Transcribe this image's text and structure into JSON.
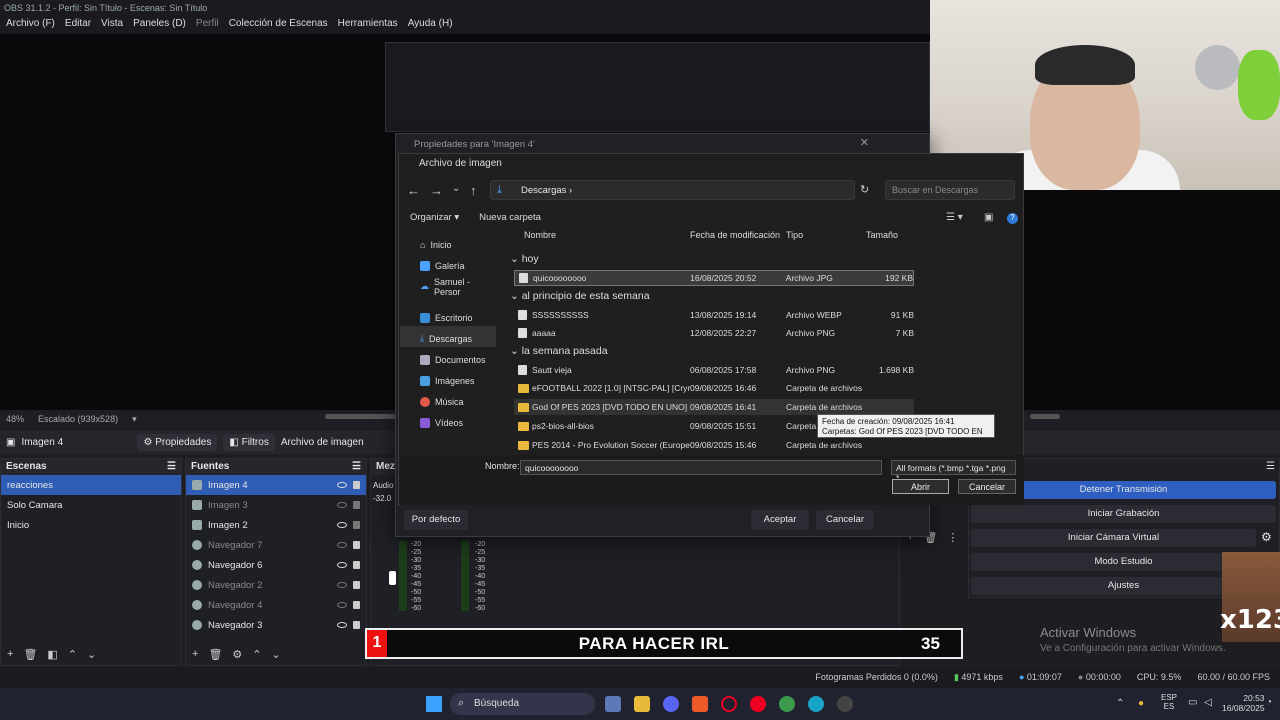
{
  "titlebar": "OBS 31.1.2 - Perfil: Sin Título - Escenas: Sin Título",
  "menu": [
    "Archivo (F)",
    "Editar",
    "Vista",
    "Paneles (D)",
    "Perfil",
    "Colección de Escenas",
    "Herramientas",
    "Ayuda (H)"
  ],
  "previewbar": {
    "zoom": "48%",
    "scale": "Escalado (939x528)"
  },
  "sourcebar": {
    "selected": "Imagen 4",
    "props": "Propiedades",
    "filters": "Filtros",
    "file": "Archivo de imagen"
  },
  "scenes": {
    "title": "Escenas",
    "items": [
      "reacciones",
      "Solo Camara",
      "Inicio"
    ]
  },
  "sources": {
    "title": "Fuentes",
    "items": [
      {
        "name": "Imagen 4",
        "visible": true
      },
      {
        "name": "Imagen 3",
        "visible": false
      },
      {
        "name": "Imagen 2",
        "visible": true
      },
      {
        "name": "Navegador 7",
        "visible": false
      },
      {
        "name": "Navegador 6",
        "visible": true
      },
      {
        "name": "Navegador 2",
        "visible": false
      },
      {
        "name": "Navegador 4",
        "visible": false
      },
      {
        "name": "Navegador 3",
        "visible": true
      }
    ]
  },
  "mixer": {
    "title": "Mezc",
    "audio": "Audio",
    "db": "-32.0",
    "ticks": [
      "-20",
      "-25",
      "-30",
      "-35",
      "-40",
      "-45",
      "-50",
      "-55",
      "-60"
    ]
  },
  "controls": [
    "Detener Transmisión",
    "Iniciar Grabación",
    "Iniciar Cámara Virtual",
    "Modo Estudio",
    "Ajustes"
  ],
  "props_dialog": {
    "title": "Propiedades para 'Imagen 4'",
    "default": "Por defecto",
    "accept": "Aceptar",
    "cancel": "Cancelar"
  },
  "file_dialog": {
    "title": "Archivo de imagen",
    "path": "Descargas",
    "search": "Buscar en Descargas",
    "organize": "Organizar",
    "newfolder": "Nueva carpeta",
    "sidebar": [
      "Inicio",
      "Galería",
      "Samuel - Persor",
      "Escritorio",
      "Descargas",
      "Documentos",
      "Imágenes",
      "Música",
      "Vídeos"
    ],
    "columns": [
      "Nombre",
      "Fecha de modificación",
      "Tipo",
      "Tamaño"
    ],
    "groups": [
      "hoy",
      "al principio de esta semana",
      "la semana pasada"
    ],
    "files": [
      {
        "n": "quicoooooooo",
        "d": "16/08/2025 20:52",
        "t": "Archivo JPG",
        "s": "192 KB"
      },
      {
        "n": "SSSSSSSSSS",
        "d": "13/08/2025 19:14",
        "t": "Archivo WEBP",
        "s": "91 KB"
      },
      {
        "n": "aaaaa",
        "d": "12/08/2025 22:27",
        "t": "Archivo PNG",
        "s": "7 KB"
      },
      {
        "n": "Sautt vieja",
        "d": "06/08/2025 17:58",
        "t": "Archivo PNG",
        "s": "1.698 KB"
      },
      {
        "n": "eFOOTBALL 2022 [1.0] [NTSC-PAL] [Crym...",
        "d": "09/08/2025 16:46",
        "t": "Carpeta de archivos",
        "s": ""
      },
      {
        "n": "God Of PES 2023 [DVD TODO EN UNO]",
        "d": "09/08/2025 16:41",
        "t": "Carpeta de archivos",
        "s": ""
      },
      {
        "n": "ps2-bios-all-bios",
        "d": "09/08/2025 15:51",
        "t": "Carpeta",
        "s": ""
      },
      {
        "n": "PES 2014 - Pro Evolution Soccer (Europe) ...",
        "d": "09/08/2025 15:46",
        "t": "Carpeta de archivos",
        "s": ""
      }
    ],
    "tooltip1": "Fecha de creación: 09/08/2025 16:41",
    "tooltip2": "Carpetas: God Of PES 2023 [DVD TODO EN UNO]",
    "name_label": "Nombre:",
    "name_value": "quicoooooooo",
    "filter": "All formats (*.bmp *.tga *.png *",
    "open": "Abrir",
    "cancel": "Cancelar"
  },
  "overlay": {
    "num": "1",
    "text": "PARA HACER IRL",
    "right": "35"
  },
  "watermark": {
    "line1": "Activar Windows",
    "line2": "Ve a Configuración para activar Windows."
  },
  "sticker": "x123",
  "status": {
    "dropped": "Fotogramas Perdidos 0 (0.0%)",
    "kbps": "4971 kbps",
    "live": "01:09:07",
    "rec": "00:00:00",
    "cpu": "CPU: 9.5%",
    "fps": "60.00 / 60.00 FPS"
  },
  "taskbar": {
    "search": "Búsqueda",
    "lang1": "ESP",
    "lang2": "ES",
    "time": "20:53",
    "date": "16/08/2025"
  }
}
